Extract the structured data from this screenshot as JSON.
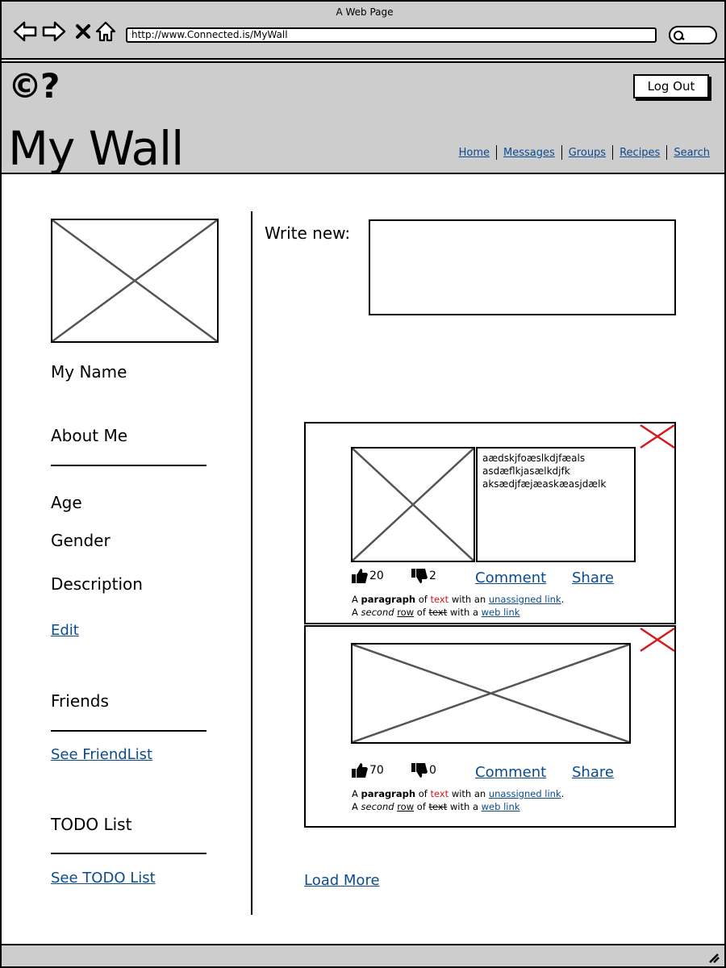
{
  "browser": {
    "window_title": "A Web Page",
    "url": "http://www.Connected.is/MyWall",
    "icons": [
      "back-icon",
      "forward-icon",
      "stop-icon",
      "home-icon",
      "search-icon"
    ]
  },
  "header": {
    "logo": "©?",
    "title": "My Wall",
    "logout_label": "Log Out",
    "nav": [
      "Home",
      "Messages",
      "Groups",
      "Recipes",
      "Search"
    ]
  },
  "sidebar": {
    "name": "My Name",
    "about_heading": "About Me",
    "age": "Age",
    "gender": "Gender",
    "description": "Description",
    "edit_link": "Edit",
    "friends_heading": "Friends",
    "friends_link": "See FriendList",
    "todo_heading": "TODO List",
    "todo_link": "See TODO List"
  },
  "compose": {
    "label": "Write new:"
  },
  "posts": [
    {
      "text_lines": [
        "aædskjfoæslkdjfæals",
        "asdæflkjasælkdjfk",
        "aksædjfæjæaskæasjdælk"
      ],
      "likes": "20",
      "dislikes": "2",
      "comment_label": "Comment",
      "share_label": "Share"
    },
    {
      "likes": "70",
      "dislikes": "0",
      "comment_label": "Comment",
      "share_label": "Share"
    }
  ],
  "paragraph": {
    "a": "A",
    "bold": "paragraph",
    "of": "of",
    "red": "text",
    "with_an": "with an",
    "link1": "unassigned link",
    "dot": ".",
    "a2": "A",
    "italic": "second",
    "underlined": "row",
    "of2": "of",
    "struck": "text",
    "with_a": "with a",
    "link2": "web link"
  },
  "load_more": "Load More",
  "colors": {
    "chrome": "#cdcdcd",
    "link": "#0b4b8f",
    "red": "#d61818"
  }
}
